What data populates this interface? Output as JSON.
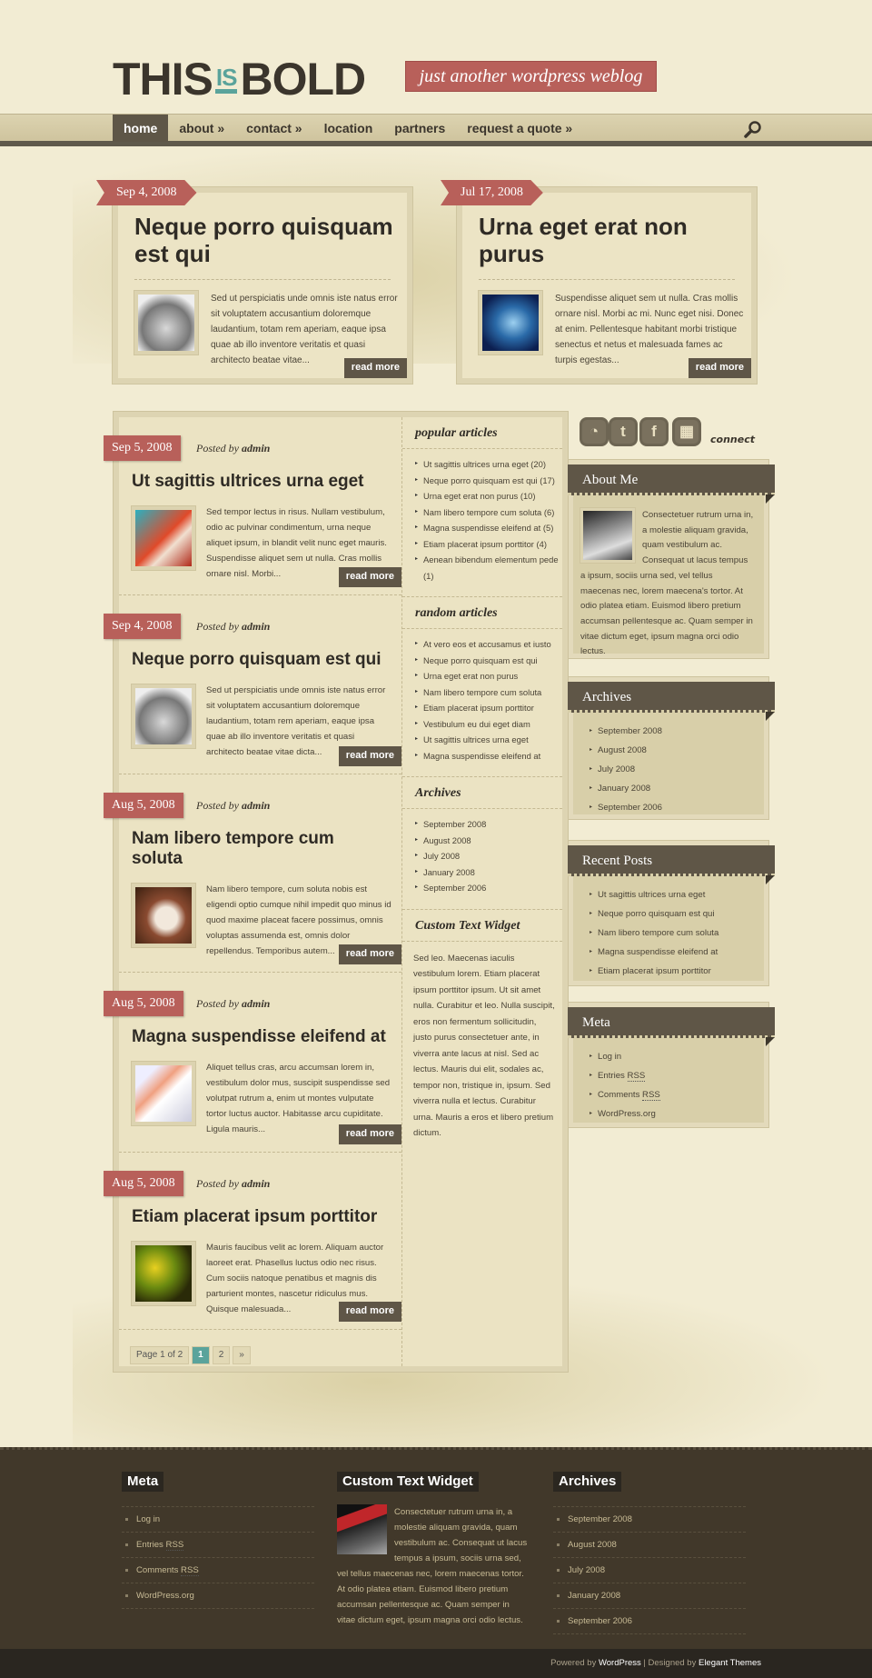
{
  "header": {
    "logo": {
      "left": "THIS",
      "middle": "IS",
      "right": "BOLD"
    },
    "tagline": "just another wordpress weblog"
  },
  "nav": {
    "items": [
      {
        "label": "home",
        "active": true
      },
      {
        "label": "about »"
      },
      {
        "label": "contact »"
      },
      {
        "label": "location"
      },
      {
        "label": "partners"
      },
      {
        "label": "request a quote »"
      }
    ],
    "search_icon": "search-icon"
  },
  "featured": [
    {
      "date": "Sep 4, 2008",
      "title": "Neque porro quisquam est qui",
      "excerpt": "Sed ut perspiciatis unde omnis iste natus error sit voluptatem accusantium doloremque laudantium, totam rem aperiam, eaque ipsa quae ab illo inventore veritatis et quasi architecto beatae vitae...",
      "read_more": "read more"
    },
    {
      "date": "Jul 17, 2008",
      "title": "Urna eget erat non purus",
      "excerpt": "Suspendisse aliquet sem ut nulla. Cras mollis ornare nisl. Morbi ac mi. Nunc eget nisi. Donec at enim. Pellentesque habitant morbi tristique senectus et netus et malesuada fames ac turpis egestas...",
      "read_more": "read more"
    }
  ],
  "posts": [
    {
      "date": "Sep 5, 2008",
      "posted_by": "Posted by",
      "author": "admin",
      "title": "Ut sagittis ultrices urna eget",
      "excerpt": "Sed tempor lectus in risus. Nullam vestibulum, odio ac pulvinar condimentum, urna neque aliquet ipsum, in blandit velit nunc eget mauris. Suspendisse aliquet sem ut nulla. Cras mollis ornare nisl. Morbi...",
      "read_more": "read more"
    },
    {
      "date": "Sep 4, 2008",
      "posted_by": "Posted by",
      "author": "admin",
      "title": "Neque porro quisquam est qui",
      "excerpt": "Sed ut perspiciatis unde omnis iste natus error sit voluptatem accusantium doloremque laudantium, totam rem aperiam, eaque ipsa quae ab illo inventore veritatis et quasi architecto beatae vitae dicta...",
      "read_more": "read more"
    },
    {
      "date": "Aug 5, 2008",
      "posted_by": "Posted by",
      "author": "admin",
      "title": "Nam libero tempore cum soluta",
      "excerpt": "Nam libero tempore, cum soluta nobis est eligendi optio cumque nihil impedit quo minus id quod maxime placeat facere possimus, omnis voluptas assumenda est, omnis dolor repellendus. Temporibus autem...",
      "read_more": "read more"
    },
    {
      "date": "Aug 5, 2008",
      "posted_by": "Posted by",
      "author": "admin",
      "title": "Magna suspendisse eleifend at",
      "excerpt": "Aliquet tellus cras, arcu accumsan lorem in, vestibulum dolor mus, suscipit suspendisse sed volutpat rutrum a, enim ut montes vulputate tortor luctus auctor. Habitasse arcu cupiditate. Ligula mauris...",
      "read_more": "read more"
    },
    {
      "date": "Aug 5, 2008",
      "posted_by": "Posted by",
      "author": "admin",
      "title": "Etiam placerat ipsum porttitor",
      "excerpt": "Mauris faucibus velit ac lorem. Aliquam auctor laoreet erat. Phasellus luctus odio nec risus. Cum sociis natoque penatibus et magnis dis parturient montes, nascetur ridiculus mus. Quisque malesuada...",
      "read_more": "read more"
    }
  ],
  "pagination": {
    "label": "Page 1 of 2",
    "pages": [
      "1",
      "2"
    ],
    "current": "1",
    "next": "»"
  },
  "middle": {
    "popular": {
      "title": "popular articles",
      "items": [
        "Ut sagittis ultrices urna eget (20)",
        "Neque porro quisquam est qui (17)",
        "Urna eget erat non purus (10)",
        "Nam libero tempore cum soluta (6)",
        "Magna suspendisse eleifend at (5)",
        "Etiam placerat ipsum porttitor (4)",
        "Aenean bibendum elementum pede (1)"
      ]
    },
    "random": {
      "title": "random articles",
      "items": [
        "At vero eos et accusamus et iusto",
        "Neque porro quisquam est qui",
        "Urna eget erat non purus",
        "Nam libero tempore cum soluta",
        "Etiam placerat ipsum porttitor",
        "Vestibulum eu dui eget diam",
        "Ut sagittis ultrices urna eget",
        "Magna suspendisse eleifend at"
      ]
    },
    "archives": {
      "title": "Archives",
      "items": [
        "September 2008",
        "August 2008",
        "July 2008",
        "January 2008",
        "September 2006"
      ]
    },
    "custom": {
      "title": "Custom Text Widget",
      "text": "Sed leo. Maecenas iaculis vestibulum lorem. Etiam placerat ipsum porttitor ipsum. Ut sit amet nulla. Curabitur et leo. Nulla suscipit, eros non fermentum sollicitudin, justo purus consectetuer ante, in viverra ante lacus at nisl. Sed ac lectus. Mauris dui elit, sodales ac, tempor non, tristique in, ipsum. Sed viverra nulla et lectus. Curabitur urna. Mauris a eros et libero pretium dictum."
    }
  },
  "social": {
    "icons": [
      "rss-icon",
      "twitter-icon",
      "facebook-icon",
      "delicious-icon"
    ],
    "connect": "connect"
  },
  "sidebar": {
    "about": {
      "title": "About Me",
      "text": "Consectetuer rutrum urna in, a molestie aliquam gravida, quam vestibulum ac. Consequat ut lacus tempus a ipsum, sociis urna sed, vel tellus maecenas nec, lorem maecena's tortor. At odio platea etiam. Euismod libero pretium accumsan pellentesque ac. Quam semper in vitae dictum eget, ipsum magna orci odio lectus."
    },
    "archives": {
      "title": "Archives",
      "items": [
        "September 2008",
        "August 2008",
        "July 2008",
        "January 2008",
        "September 2006"
      ]
    },
    "recent": {
      "title": "Recent Posts",
      "items": [
        "Ut sagittis ultrices urna eget",
        "Neque porro quisquam est qui",
        "Nam libero tempore cum soluta",
        "Magna suspendisse eleifend at",
        "Etiam placerat ipsum porttitor"
      ]
    },
    "meta": {
      "title": "Meta",
      "items": [
        "Log in",
        "Entries RSS",
        "Comments RSS",
        "WordPress.org"
      ]
    }
  },
  "footer": {
    "meta": {
      "title": "Meta",
      "items": [
        "Log in",
        "Entries RSS",
        "Comments RSS",
        "WordPress.org"
      ]
    },
    "custom": {
      "title": "Custom Text Widget",
      "text": "Consectetuer rutrum urna in, a molestie aliquam gravida, quam vestibulum ac. Consequat ut lacus tempus a ipsum, sociis urna sed, vel tellus maecenas nec, lorem maecenas tortor. At odio platea etiam. Euismod libero pretium accumsan pellentesque ac. Quam semper in vitae dictum eget, ipsum magna orci odio lectus."
    },
    "archives": {
      "title": "Archives",
      "items": [
        "September 2008",
        "August 2008",
        "July 2008",
        "January 2008",
        "September 2006"
      ]
    },
    "credits": {
      "powered": "Powered by",
      "wordpress": "WordPress",
      "sep": "| Designed by",
      "designer": "Elegant Themes"
    }
  },
  "colors": {
    "accent_red": "#b8605a",
    "teal": "#5aa39b",
    "dark_brown": "#5f5647",
    "footer_bg": "#41382a",
    "cream": "#f2ecd3"
  }
}
